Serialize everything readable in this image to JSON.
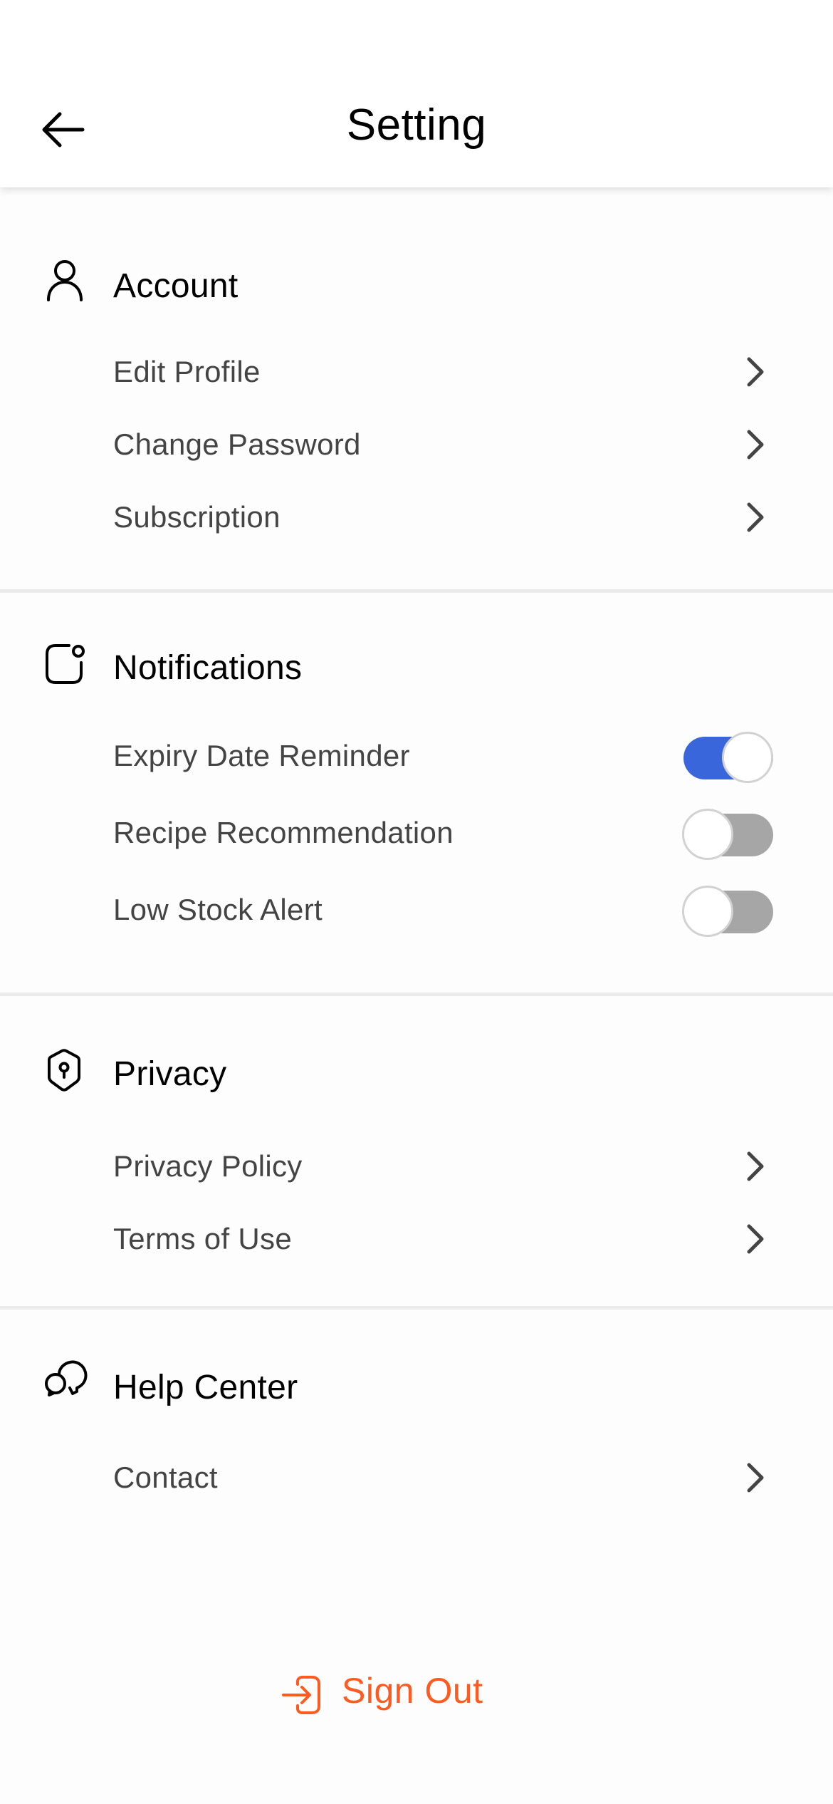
{
  "header": {
    "title": "Setting",
    "back_icon": "arrow-left-icon"
  },
  "sections": {
    "account": {
      "title": "Account",
      "icon": "user-icon",
      "items": [
        {
          "label": "Edit Profile",
          "icon": "chevron-right-icon"
        },
        {
          "label": "Change Password",
          "icon": "chevron-right-icon"
        },
        {
          "label": "Subscription",
          "icon": "chevron-right-icon"
        }
      ]
    },
    "notifications": {
      "title": "Notifications",
      "icon": "notification-icon",
      "items": [
        {
          "label": "Expiry Date Reminder",
          "enabled": true
        },
        {
          "label": "Recipe Recommendation",
          "enabled": false
        },
        {
          "label": "Low Stock Alert",
          "enabled": false
        }
      ]
    },
    "privacy": {
      "title": "Privacy",
      "icon": "shield-keyhole-icon",
      "items": [
        {
          "label": "Privacy Policy",
          "icon": "chevron-right-icon"
        },
        {
          "label": "Terms of Use",
          "icon": "chevron-right-icon"
        }
      ]
    },
    "help": {
      "title": "Help Center",
      "icon": "chat-bubbles-icon",
      "items": [
        {
          "label": "Contact",
          "icon": "chevron-right-icon"
        }
      ]
    }
  },
  "signout": {
    "label": "Sign Out",
    "icon": "sign-out-icon"
  },
  "colors": {
    "accent": "#3a66dc",
    "toggle_off": "#a6a6a6",
    "signout": "#ff5a1f",
    "item_text": "#444444",
    "divider": "#ebebeb"
  }
}
